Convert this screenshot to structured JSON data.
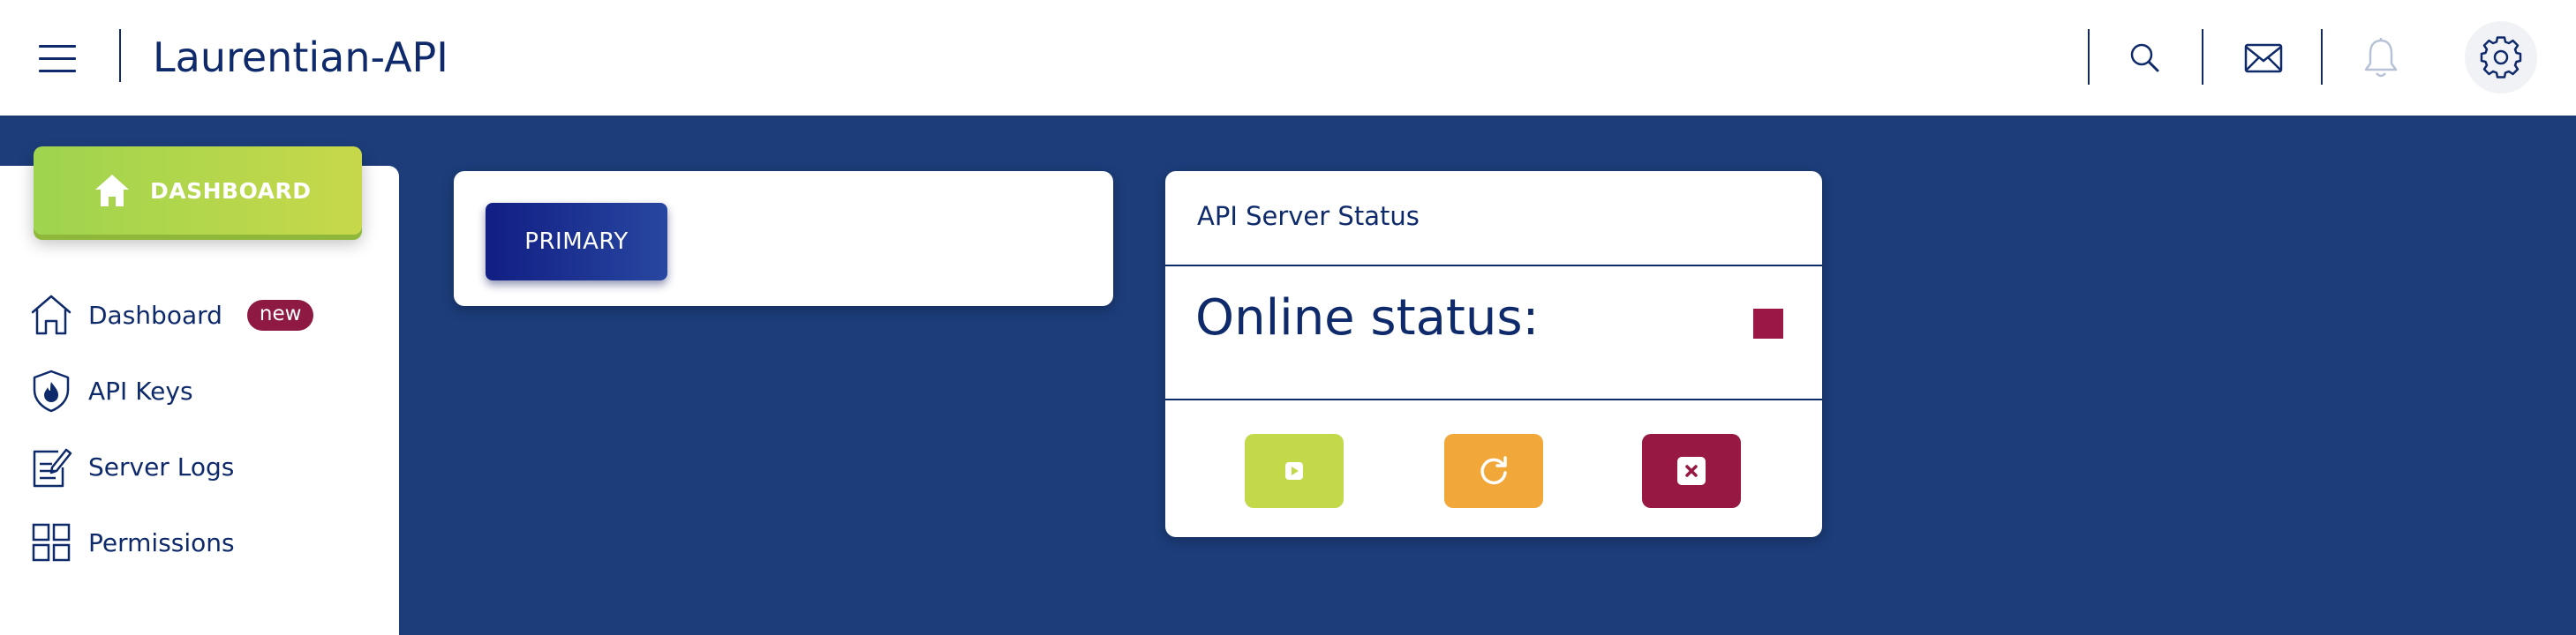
{
  "header": {
    "app_title": "Laurentian-API"
  },
  "sidebar": {
    "dashboard_button_label": "DASHBOARD",
    "items": [
      {
        "label": "Dashboard",
        "badge": "new",
        "icon": "home-outline-icon"
      },
      {
        "label": "API Keys",
        "icon": "shield-flame-icon"
      },
      {
        "label": "Server Logs",
        "icon": "document-edit-icon"
      },
      {
        "label": "Permissions",
        "icon": "grid-icon"
      }
    ]
  },
  "primary_card": {
    "button_label": "PRIMARY"
  },
  "status_card": {
    "title": "API Server Status",
    "online_label": "Online status:",
    "status_indicator_color": "#9b1745",
    "controls": [
      {
        "action": "start",
        "icon": "play-icon",
        "color": "#c4d94a"
      },
      {
        "action": "restart",
        "icon": "refresh-icon",
        "color": "#f2a839"
      },
      {
        "action": "stop",
        "icon": "close-square-icon",
        "color": "#971843"
      }
    ]
  },
  "colors": {
    "background": "#1c3d7a",
    "navy": "#0f2a6b",
    "badge": "#8e1a44"
  }
}
